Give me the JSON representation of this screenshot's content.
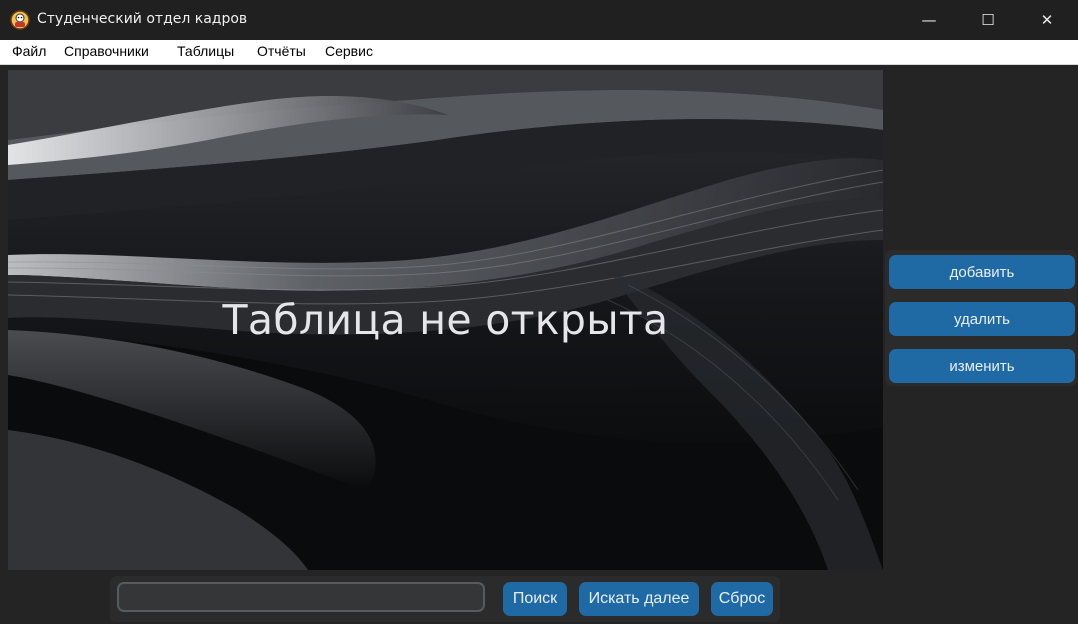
{
  "window": {
    "title": "Студенческий отдел кадров",
    "controls": {
      "minimize": "—",
      "maximize": "☐",
      "close": "✕"
    }
  },
  "menu": {
    "items": [
      "Файл",
      "Справочники",
      "Таблицы",
      "Отчёты",
      "Сервис"
    ]
  },
  "main": {
    "message": "Таблица не открыта"
  },
  "side_actions": {
    "add_label": "добавить",
    "delete_label": "удалить",
    "edit_label": "изменить"
  },
  "search": {
    "value": "",
    "placeholder": "",
    "search_label": "Поиск",
    "next_label": "Искать далее",
    "reset_label": "Сброс"
  },
  "colors": {
    "accent": "#1f6aa5",
    "panel": "#2b2b2b",
    "window_bg": "#242424"
  }
}
